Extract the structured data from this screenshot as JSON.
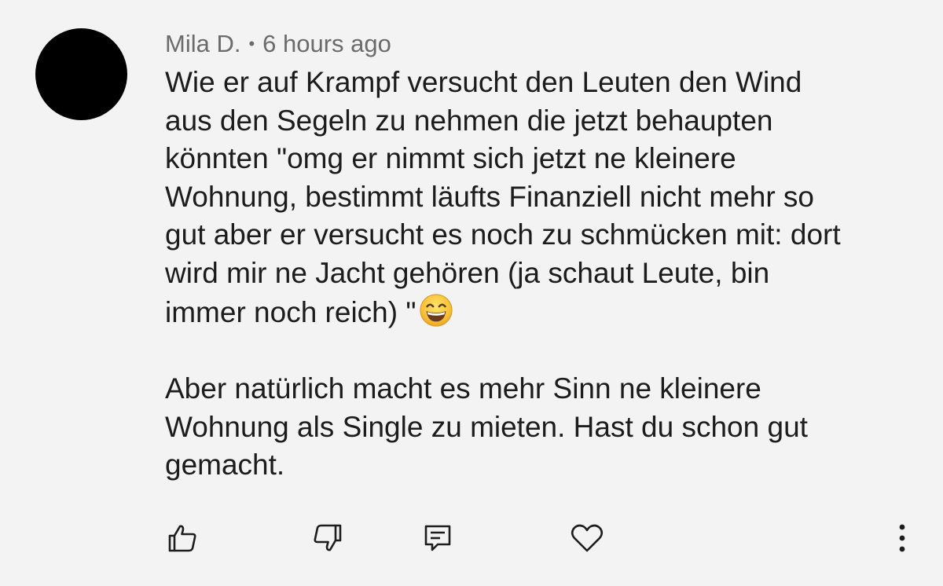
{
  "comment": {
    "author": "Mila D.",
    "separator": "•",
    "timestamp": "6 hours ago",
    "paragraph1_lines": [
      "Wie er auf Krampf versucht den Leuten den Wind",
      "aus den Segeln zu nehmen die jetzt behaupten",
      "könnten \"omg er nimmt sich jetzt ne kleinere",
      "Wohnung, bestimmt läufts Finanziell nicht mehr so",
      "gut aber er versucht es noch zu schmücken mit: dort",
      "wird mir ne Jacht gehören (ja schaut Leute, bin",
      "immer noch reich) \""
    ],
    "paragraph2_lines": [
      "Aber natürlich macht es mehr Sinn ne kleinere",
      "Wohnung als Single zu mieten. Hast du schon gut",
      "gemacht."
    ],
    "emoji": "grinning-face-with-smiling-eyes-icon"
  },
  "actions": {
    "like": "thumbs-up-icon",
    "dislike": "thumbs-down-icon",
    "reply": "reply-comment-icon",
    "heart": "heart-icon",
    "more": "more-vertical-icon"
  },
  "colors": {
    "background": "#f3f3f3",
    "text": "#1c1c1c",
    "meta": "#6b6b6b",
    "avatar": "#000000",
    "icon": "#1d1d1d"
  }
}
